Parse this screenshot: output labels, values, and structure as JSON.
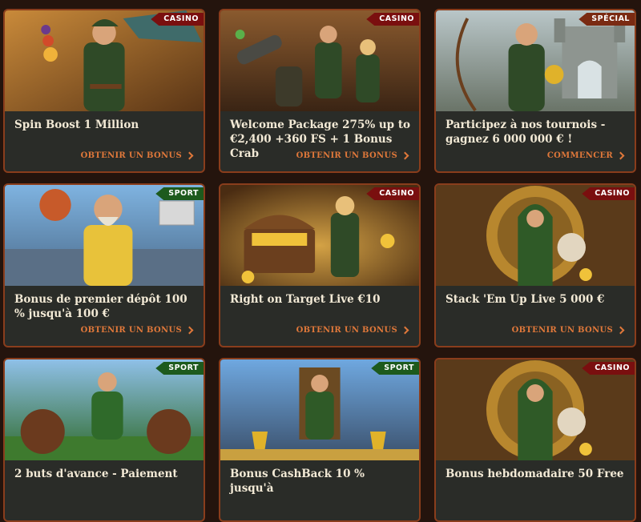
{
  "cards": [
    {
      "badge": "CASINO",
      "title": "Spin Boost 1 Million",
      "cta": "OBTENIR UN BONUS",
      "art": "archer-hero-icon"
    },
    {
      "badge": "CASINO",
      "title": "Welcome Package 275% up to €2,400 +360 FS + 1 Bonus Crab",
      "cta": "OBTENIR UN BONUS",
      "art": "outlaw-band-icon"
    },
    {
      "badge": "SPÉCIAL",
      "title": "Participez à nos tournois - gagnez 6 000 000 € !",
      "cta": "COMMENCER",
      "art": "castle-archer-icon"
    },
    {
      "badge": "SPORT",
      "title": "Bonus de premier dépôt 100 % jusqu'à 100 €",
      "cta": "OBTENIR UN BONUS",
      "art": "basketball-player-icon"
    },
    {
      "badge": "CASINO",
      "title": "Right on Target Live €10",
      "cta": "OBTENIR UN BONUS",
      "art": "treasure-chest-icon"
    },
    {
      "badge": "CASINO",
      "title": "Stack 'Em Up Live 5 000 €",
      "cta": "OBTENIR UN BONUS",
      "art": "hooded-hero-vault-icon"
    },
    {
      "badge": "SPORT",
      "title": "2 buts d'avance - Paiement",
      "cta": "",
      "art": "football-player-icon"
    },
    {
      "badge": "SPORT",
      "title": "Bonus CashBack 10 % jusqu'à",
      "cta": "",
      "art": "throne-king-icon"
    },
    {
      "badge": "CASINO",
      "title": "Bonus hebdomadaire 50 Free",
      "cta": "",
      "art": "hooded-hero-vault-icon"
    }
  ]
}
